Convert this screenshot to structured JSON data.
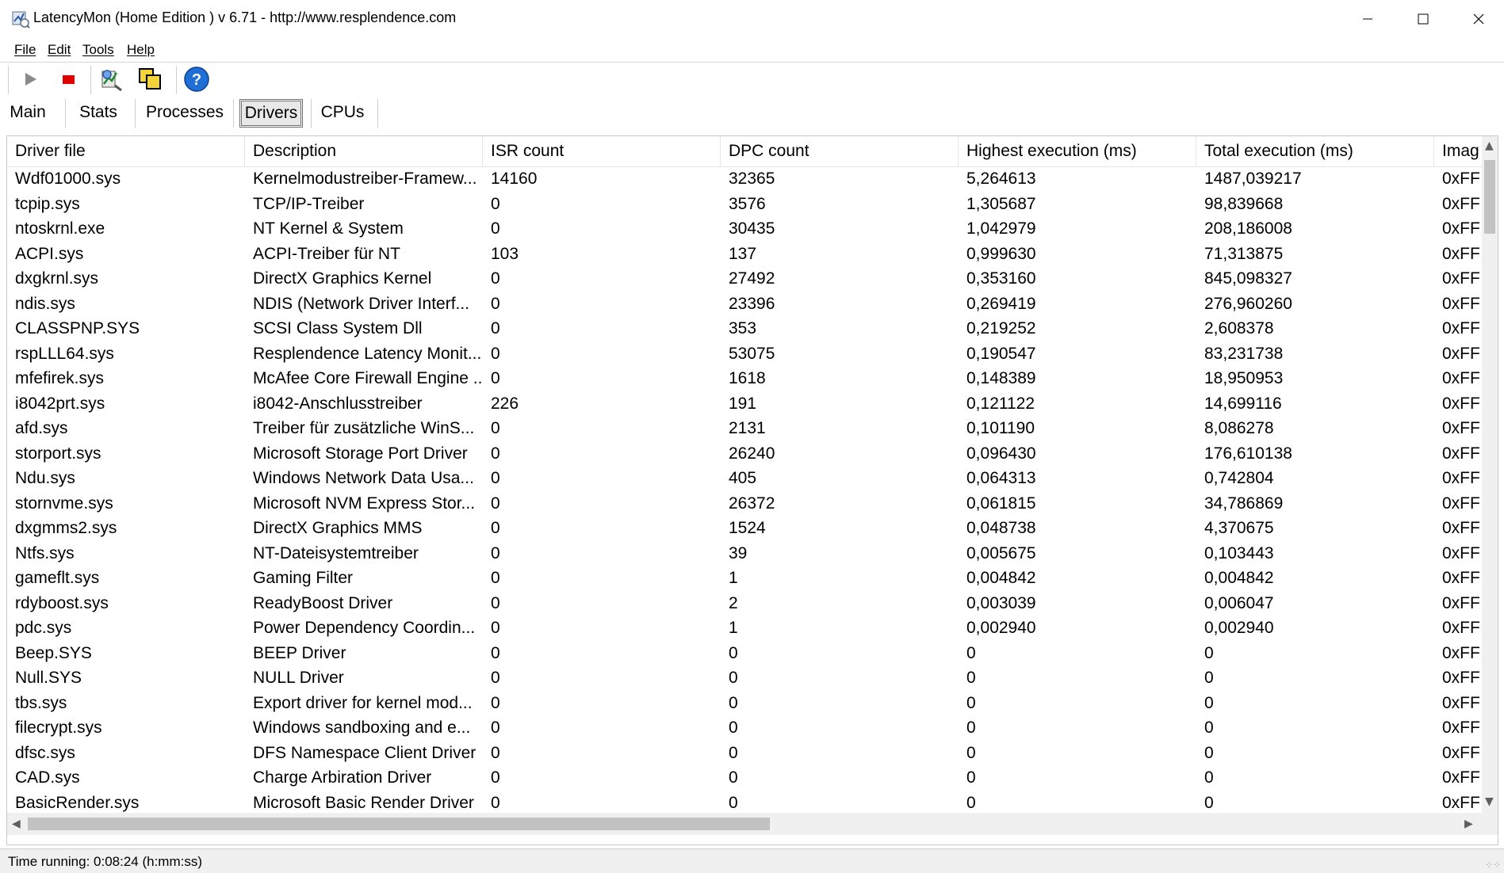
{
  "window": {
    "title": "LatencyMon  (Home Edition )  v 6.71 - http://www.resplendence.com",
    "icon": "latencymon-app-icon"
  },
  "menu": [
    {
      "label": "File"
    },
    {
      "label": "Edit"
    },
    {
      "label": "Tools"
    },
    {
      "label": "Help"
    }
  ],
  "toolbar": {
    "buttons": [
      {
        "name": "start-icon"
      },
      {
        "name": "stop-icon"
      },
      {
        "name": "driver-analyze-icon"
      },
      {
        "name": "copy-icon"
      },
      {
        "name": "help-icon"
      }
    ]
  },
  "tabs": [
    {
      "label": "Main"
    },
    {
      "label": "Stats"
    },
    {
      "label": "Processes"
    },
    {
      "label": "Drivers",
      "active": true
    },
    {
      "label": "CPUs"
    }
  ],
  "grid": {
    "columns": [
      "Driver file",
      "Description",
      "ISR count",
      "DPC count",
      "Highest execution (ms)",
      "Total execution (ms)",
      "Imag"
    ],
    "rows": [
      [
        "Wdf01000.sys",
        "Kernelmodustreiber-Framew...",
        "14160",
        "32365",
        "5,264613",
        "1487,039217",
        "0xFF"
      ],
      [
        "tcpip.sys",
        "TCP/IP-Treiber",
        "0",
        "3576",
        "1,305687",
        "98,839668",
        "0xFF"
      ],
      [
        "ntoskrnl.exe",
        "NT Kernel & System",
        "0",
        "30435",
        "1,042979",
        "208,186008",
        "0xFF"
      ],
      [
        "ACPI.sys",
        "ACPI-Treiber für NT",
        "103",
        "137",
        "0,999630",
        "71,313875",
        "0xFF"
      ],
      [
        "dxgkrnl.sys",
        "DirectX Graphics Kernel",
        "0",
        "27492",
        "0,353160",
        "845,098327",
        "0xFF"
      ],
      [
        "ndis.sys",
        "NDIS (Network Driver Interf...",
        "0",
        "23396",
        "0,269419",
        "276,960260",
        "0xFF"
      ],
      [
        "CLASSPNP.SYS",
        "SCSI Class System Dll",
        "0",
        "353",
        "0,219252",
        "2,608378",
        "0xFF"
      ],
      [
        "rspLLL64.sys",
        "Resplendence Latency Monit...",
        "0",
        "53075",
        "0,190547",
        "83,231738",
        "0xFF"
      ],
      [
        "mfefirek.sys",
        "McAfee Core Firewall Engine ...",
        "0",
        "1618",
        "0,148389",
        "18,950953",
        "0xFF"
      ],
      [
        "i8042prt.sys",
        "i8042-Anschlusstreiber",
        "226",
        "191",
        "0,121122",
        "14,699116",
        "0xFF"
      ],
      [
        "afd.sys",
        "Treiber für zusätzliche WinS...",
        "0",
        "2131",
        "0,101190",
        "8,086278",
        "0xFF"
      ],
      [
        "storport.sys",
        "Microsoft Storage Port Driver",
        "0",
        "26240",
        "0,096430",
        "176,610138",
        "0xFF"
      ],
      [
        "Ndu.sys",
        "Windows Network Data Usa...",
        "0",
        "405",
        "0,064313",
        "0,742804",
        "0xFF"
      ],
      [
        "stornvme.sys",
        "Microsoft NVM Express Stor...",
        "0",
        "26372",
        "0,061815",
        "34,786869",
        "0xFF"
      ],
      [
        "dxgmms2.sys",
        "DirectX Graphics MMS",
        "0",
        "1524",
        "0,048738",
        "4,370675",
        "0xFF"
      ],
      [
        "Ntfs.sys",
        "NT-Dateisystemtreiber",
        "0",
        "39",
        "0,005675",
        "0,103443",
        "0xFF"
      ],
      [
        "gameflt.sys",
        "Gaming Filter",
        "0",
        "1",
        "0,004842",
        "0,004842",
        "0xFF"
      ],
      [
        "rdyboost.sys",
        "ReadyBoost Driver",
        "0",
        "2",
        "0,003039",
        "0,006047",
        "0xFF"
      ],
      [
        "pdc.sys",
        "Power Dependency Coordin...",
        "0",
        "1",
        "0,002940",
        "0,002940",
        "0xFF"
      ],
      [
        "Beep.SYS",
        "BEEP Driver",
        "0",
        "0",
        "0",
        "0",
        "0xFF"
      ],
      [
        "Null.SYS",
        "NULL Driver",
        "0",
        "0",
        "0",
        "0",
        "0xFF"
      ],
      [
        "tbs.sys",
        "Export driver for kernel mod...",
        "0",
        "0",
        "0",
        "0",
        "0xFF"
      ],
      [
        "filecrypt.sys",
        "Windows sandboxing and e...",
        "0",
        "0",
        "0",
        "0",
        "0xFF"
      ],
      [
        "dfsc.sys",
        "DFS Namespace Client Driver",
        "0",
        "0",
        "0",
        "0",
        "0xFF"
      ],
      [
        "CAD.sys",
        "Charge Arbiration Driver",
        "0",
        "0",
        "0",
        "0",
        "0xFF"
      ],
      [
        "BasicRender.sys",
        "Microsoft Basic Render Driver",
        "0",
        "0",
        "0",
        "0",
        "0xFF"
      ]
    ]
  },
  "status": {
    "text": "Time running: 0:08:24  (h:mm:ss)"
  },
  "colors": {
    "stop": "#e00000",
    "help": "#1f6fd6",
    "play": "#8a8a8a"
  }
}
